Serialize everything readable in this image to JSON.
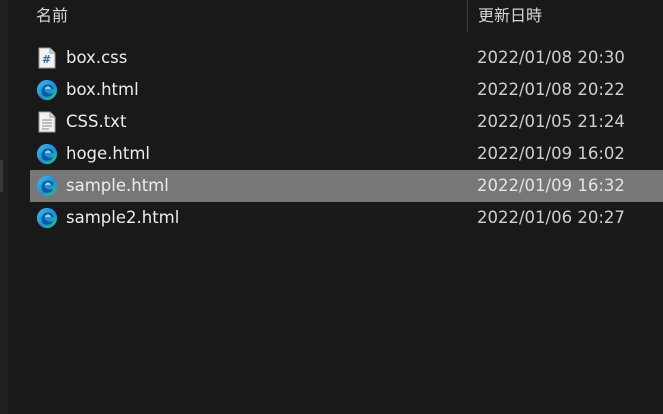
{
  "columns": {
    "name": "名前",
    "modified": "更新日時"
  },
  "files": [
    {
      "name": "box.css",
      "modified": "2022/01/08 20:30",
      "icon": "css-file-icon",
      "selected": false
    },
    {
      "name": "box.html",
      "modified": "2022/01/08 20:22",
      "icon": "edge-html-icon",
      "selected": false
    },
    {
      "name": "CSS.txt",
      "modified": "2022/01/05 21:24",
      "icon": "text-file-icon",
      "selected": false
    },
    {
      "name": "hoge.html",
      "modified": "2022/01/09 16:02",
      "icon": "edge-html-icon",
      "selected": false
    },
    {
      "name": "sample.html",
      "modified": "2022/01/09 16:32",
      "icon": "edge-html-icon",
      "selected": true
    },
    {
      "name": "sample2.html",
      "modified": "2022/01/06 20:27",
      "icon": "edge-html-icon",
      "selected": false
    }
  ],
  "colors": {
    "background": "#191919",
    "selected_row": "#777777",
    "text": "#ececec"
  }
}
